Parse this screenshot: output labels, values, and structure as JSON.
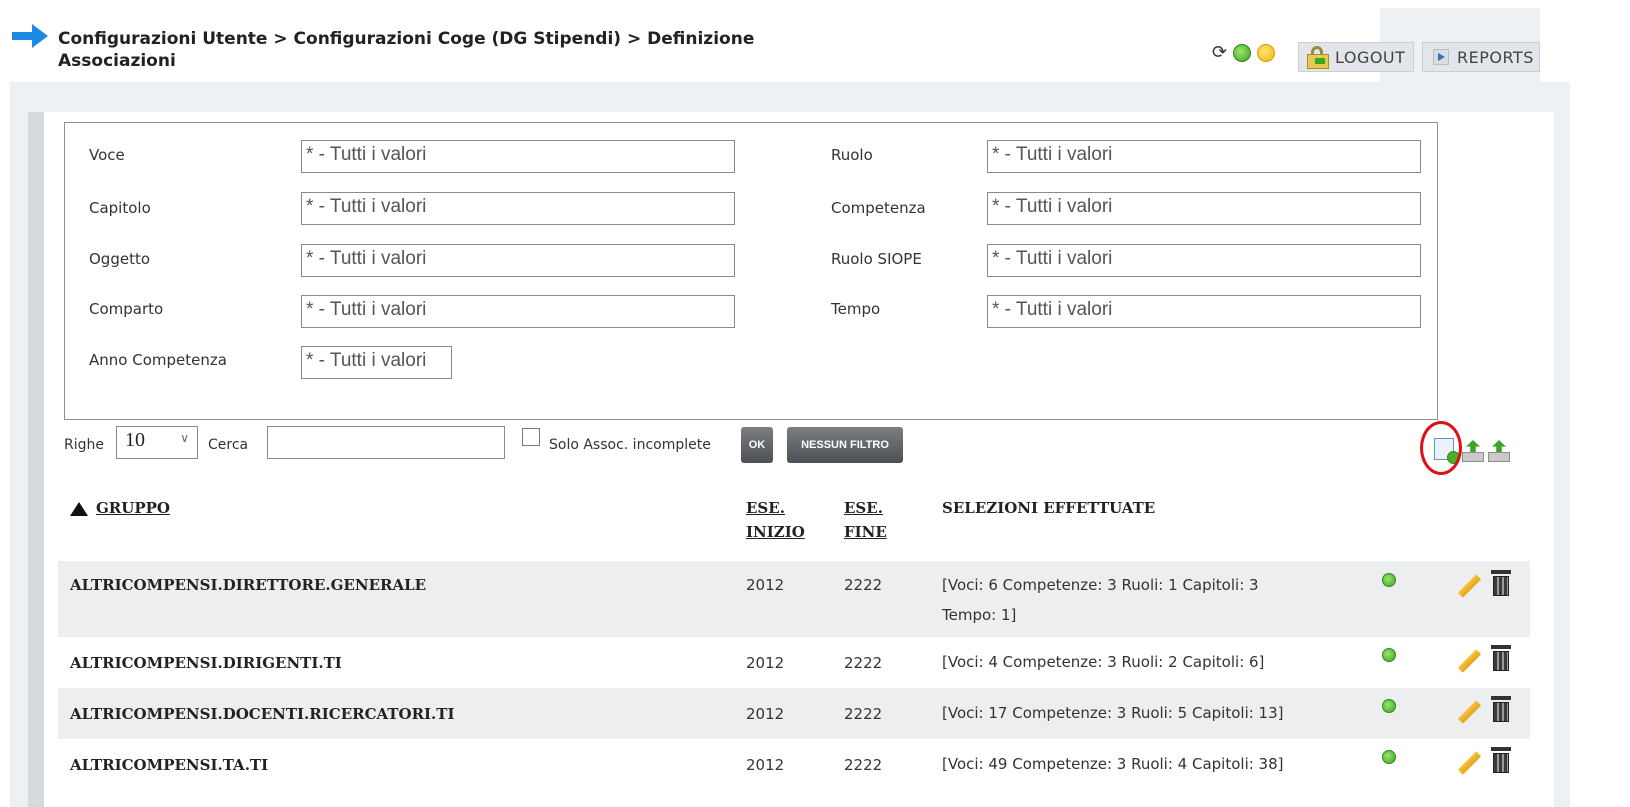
{
  "header": {
    "breadcrumb_line1": "Configurazioni Utente > Configurazioni Coge (DG Stipendi) > Definizione",
    "breadcrumb_line2": "Associazioni",
    "logout_label": "LOGOUT",
    "reports_label": "REPORTS"
  },
  "filters": {
    "left": [
      {
        "label": "Voce",
        "placeholder": "* - Tutti i valori"
      },
      {
        "label": "Capitolo",
        "placeholder": "* - Tutti i valori"
      },
      {
        "label": "Oggetto",
        "placeholder": "* - Tutti i valori"
      },
      {
        "label": "Comparto",
        "placeholder": "* - Tutti i valori"
      },
      {
        "label": "Anno Competenza",
        "placeholder": "* - Tutti i valori"
      }
    ],
    "right": [
      {
        "label": "Ruolo",
        "placeholder": "* - Tutti i valori"
      },
      {
        "label": "Competenza",
        "placeholder": "* - Tutti i valori"
      },
      {
        "label": "Ruolo SIOPE",
        "placeholder": "* - Tutti i valori"
      },
      {
        "label": "Tempo",
        "placeholder": "* - Tutti i valori"
      }
    ]
  },
  "toolbar": {
    "righe_label": "Righe",
    "righe_value": "10",
    "cerca_label": "Cerca",
    "cerca_value": "",
    "solo_label": "Solo Assoc. incomplete",
    "ok_label": "OK",
    "nessun_label": "NESSUN FILTRO"
  },
  "table": {
    "headers": {
      "gruppo": "GRUPPO",
      "ese_inizio_1": "ESE.",
      "ese_inizio_2": "INIZIO",
      "ese_fine_1": "ESE.",
      "ese_fine_2": "FINE",
      "selezioni": "SELEZIONI EFFETTUATE"
    },
    "rows": [
      {
        "gruppo": "ALTRICOMPENSI.DIRETTORE.GENERALE",
        "inizio": "2012",
        "fine": "2222",
        "sel1": "[Voci: 6 Competenze: 3 Ruoli: 1 Capitoli: 3",
        "sel2": "Tempo: 1]"
      },
      {
        "gruppo": "ALTRICOMPENSI.DIRIGENTI.TI",
        "inizio": "2012",
        "fine": "2222",
        "sel1": "[Voci: 4 Competenze: 3 Ruoli: 2 Capitoli: 6]",
        "sel2": ""
      },
      {
        "gruppo": "ALTRICOMPENSI.DOCENTI.RICERCATORI.TI",
        "inizio": "2012",
        "fine": "2222",
        "sel1": "[Voci: 17 Competenze: 3 Ruoli: 5 Capitoli: 13]",
        "sel2": ""
      },
      {
        "gruppo": "ALTRICOMPENSI.TA.TI",
        "inizio": "2012",
        "fine": "2222",
        "sel1": "[Voci: 49 Competenze: 3 Ruoli: 4 Capitoli: 38]",
        "sel2": ""
      }
    ]
  },
  "icons": {
    "nav": "arrow-right-icon",
    "refresh": "refresh-icon",
    "status_green": "status-green-icon",
    "status_yellow": "status-yellow-icon",
    "add": "add-record-icon",
    "export": "export-icon",
    "import": "import-icon",
    "edit": "pencil-icon",
    "delete": "trash-icon"
  },
  "colors": {
    "highlight_circle": "#e01010",
    "status_green": "#3aa424",
    "status_yellow": "#f4b800"
  }
}
